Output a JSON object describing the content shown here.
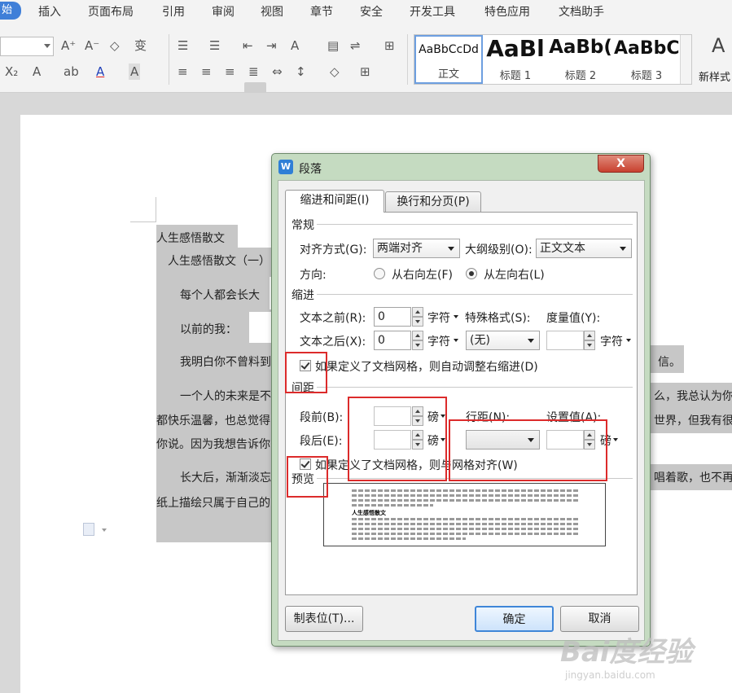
{
  "menu": {
    "active_tab": "始",
    "tabs": [
      "插入",
      "页面布局",
      "引用",
      "审阅",
      "视图",
      "章节",
      "安全",
      "开发工具",
      "特色应用",
      "文档助手"
    ]
  },
  "ribbon": {
    "styles": [
      {
        "sample": "AaBbCcDd",
        "name": "正文"
      },
      {
        "sample": "AaBl",
        "name": "标题 1"
      },
      {
        "sample": "AaBb(",
        "name": "标题 2"
      },
      {
        "sample": "AaBbC",
        "name": "标题 3"
      }
    ],
    "new_style_label": "新样式"
  },
  "document": {
    "lines": [
      "人生感悟散文",
      "人生感悟散文（一）",
      "每个人都会长大",
      "以前的我：",
      "我明白你不曾料到",
      "信。",
      "一个人的未来是不",
      "么，我总认为你",
      "都快乐温馨，也总觉得",
      "世界，但我有很",
      "你说。因为我想告诉你",
      "长大后，渐渐淡忘",
      "唱着歌，也不再",
      "纸上描绘只属于自己的"
    ]
  },
  "dialog": {
    "title": "段落",
    "close_label": "X",
    "tabs": {
      "indent": "缩进和间距(I)",
      "linebreak": "换行和分页(P)"
    },
    "general": {
      "section": "常规",
      "alignment_label": "对齐方式(G):",
      "alignment_value": "两端对齐",
      "outline_label": "大纲级别(O):",
      "outline_value": "正文文本",
      "direction_label": "方向:",
      "rtl_label": "从右向左(F)",
      "ltr_label": "从左向右(L)"
    },
    "indent": {
      "section": "缩进",
      "before_label": "文本之前(R):",
      "before_value": "0",
      "after_label": "文本之后(X):",
      "after_value": "0",
      "unit": "字符",
      "special_label": "特殊格式(S):",
      "special_value": "(无)",
      "measure_label": "度量值(Y):",
      "measure_unit": "字符",
      "auto_adjust_label": "如果定义了文档网格，则自动调整右缩进(D)"
    },
    "spacing": {
      "section": "间距",
      "before_label": "段前(B):",
      "after_label": "段后(E):",
      "unit": "磅",
      "line_label": "行距(N):",
      "setting_label": "设置值(A):",
      "setting_unit": "磅",
      "grid_align_label": "如果定义了文档网格，则与网格对齐(W)"
    },
    "preview": {
      "section": "预览",
      "sample_text": "人生感悟散文"
    },
    "buttons": {
      "tabs": "制表位(T)...",
      "ok": "确定",
      "cancel": "取消"
    }
  },
  "watermark": {
    "brand": "Bai度经验",
    "url": "jingyan.baidu.com"
  },
  "colors": {
    "annotation": "#dc2b2b",
    "dialog_frame": "#c5dbc1",
    "accent": "#3f7fd8"
  }
}
